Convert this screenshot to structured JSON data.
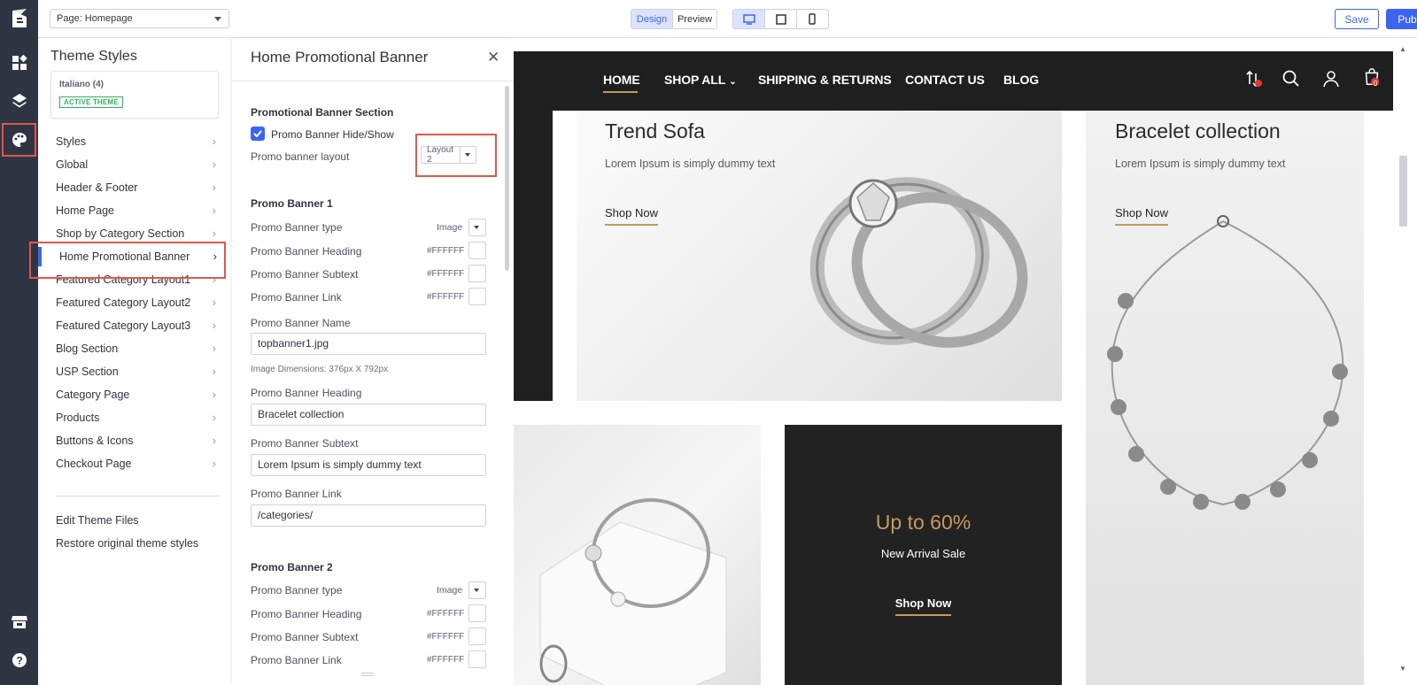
{
  "app": {
    "logo": "bigcommerce-logo"
  },
  "rail": {
    "icons": [
      "widgets-icon",
      "layers-icon",
      "palette-icon",
      "store-icon",
      "help-icon"
    ]
  },
  "topbar": {
    "page_select": "Page: Homepage",
    "mode_design": "Design",
    "mode_preview": "Preview",
    "devices": [
      "desktop-icon",
      "tablet-icon",
      "mobile-icon"
    ],
    "save": "Save",
    "publish": "Publish"
  },
  "styles": {
    "title": "Theme Styles",
    "theme_name": "Italiano (4)",
    "theme_badge": "ACTIVE THEME",
    "items": [
      {
        "label": "Styles"
      },
      {
        "label": "Global"
      },
      {
        "label": "Header & Footer"
      },
      {
        "label": "Home Page"
      },
      {
        "label": "Shop by Category Section"
      },
      {
        "label": "Home Promotional Banner"
      },
      {
        "label": "Featured Category Layout1"
      },
      {
        "label": "Featured Category Layout2"
      },
      {
        "label": "Featured Category Layout3"
      },
      {
        "label": "Blog Section"
      },
      {
        "label": "USP Section"
      },
      {
        "label": "Category Page"
      },
      {
        "label": "Products"
      },
      {
        "label": "Buttons & Icons"
      },
      {
        "label": "Checkout Page"
      }
    ],
    "edit_files": "Edit Theme Files",
    "restore": "Restore original theme styles"
  },
  "panel": {
    "title": "Home Promotional Banner",
    "section_title": "Promotional Banner Section",
    "hide_show": "Promo Banner Hide/Show",
    "layout_label": "Promo banner layout",
    "layout_value": "Layout 2",
    "banner1": {
      "title": "Promo Banner 1",
      "type_label": "Promo Banner type",
      "type_value": "Image",
      "heading_color_label": "Promo Banner Heading",
      "heading_color": "#FFFFFF",
      "subtext_color_label": "Promo Banner Subtext",
      "subtext_color": "#FFFFFF",
      "link_color_label": "Promo Banner Link",
      "link_color": "#FFFFFF",
      "name_label": "Promo Banner Name",
      "name_value": "topbanner1.jpg",
      "dims": "Image Dimensions: 376px X 792px",
      "heading_label": "Promo Banner Heading",
      "heading_value": "Bracelet collection",
      "subtext_label": "Promo Banner Subtext",
      "subtext_value": "Lorem Ipsum is simply dummy text",
      "link_label": "Promo Banner Link",
      "link_value": "/categories/"
    },
    "banner2": {
      "title": "Promo Banner 2",
      "type_label": "Promo Banner type",
      "type_value": "Image",
      "heading_color_label": "Promo Banner Heading",
      "heading_color": "#FFFFFF",
      "subtext_color_label": "Promo Banner Subtext",
      "subtext_color": "#FFFFFF",
      "link_color_label": "Promo Banner Link",
      "link_color": "#FFFFFF"
    }
  },
  "preview": {
    "nav": [
      "HOME",
      "SHOP ALL",
      "SHIPPING & RETURNS",
      "CONTACT US",
      "BLOG"
    ],
    "cart_count": "0",
    "tile1": {
      "heading": "Trend Sofa",
      "sub": "Lorem Ipsum is simply dummy text",
      "cta": "Shop Now"
    },
    "tile2": {
      "heading": "Bracelet collection",
      "sub": "Lorem Ipsum is simply dummy text",
      "cta": "Shop Now"
    },
    "tile3": {
      "heading": "Up to 60%",
      "sub": "New Arrival Sale",
      "cta": "Shop Now"
    }
  },
  "colors": {
    "accent": "#3c64f4",
    "highlight": "#e0584a",
    "gold": "#c49a5e",
    "dark": "#1f1f1f"
  }
}
